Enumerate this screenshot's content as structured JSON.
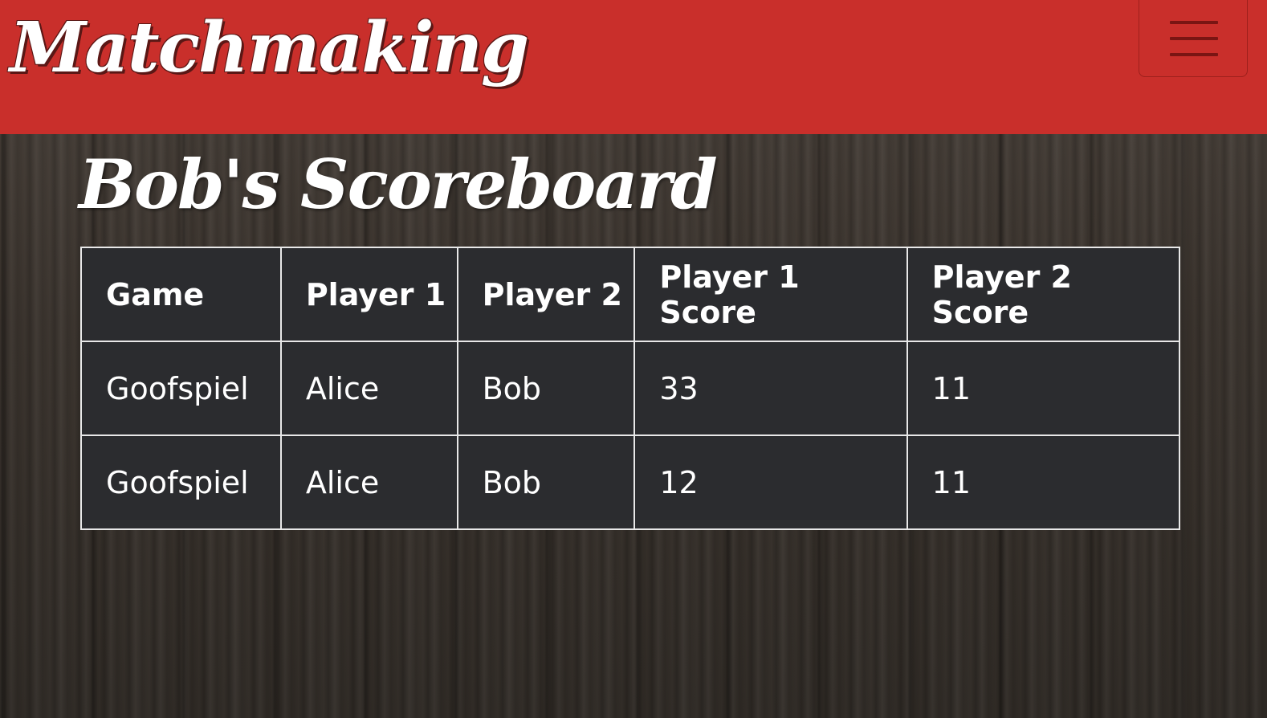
{
  "navbar": {
    "brand": "Matchmaking",
    "menu_icon": "hamburger-menu-icon"
  },
  "page": {
    "title": "Bob's Scoreboard"
  },
  "table": {
    "headers": [
      "Game",
      "Player 1",
      "Player 2",
      "Player 1 Score",
      "Player 2 Score"
    ],
    "rows": [
      [
        "Goofspiel",
        "Alice",
        "Bob",
        "33",
        "11"
      ],
      [
        "Goofspiel",
        "Alice",
        "Bob",
        "12",
        "11"
      ]
    ]
  },
  "colors": {
    "navbar": "#c92f2b",
    "table_bg": "#2b2c2f",
    "table_border": "#e8e8e8",
    "text": "#ffffff"
  }
}
